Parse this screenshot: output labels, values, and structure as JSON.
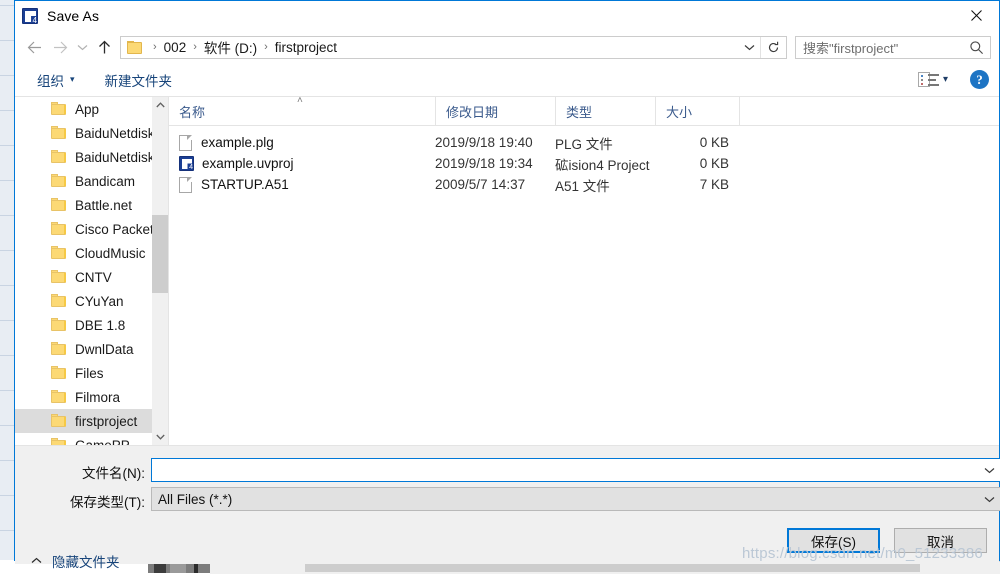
{
  "window": {
    "title": "Save As",
    "app_icon": "keil-uvision-icon",
    "close_label": "✕"
  },
  "nav": {
    "back_icon": "arrow-left-icon",
    "forward_icon": "arrow-right-icon",
    "history_icon": "chevron-down-icon",
    "up_icon": "arrow-up-icon",
    "folder_icon": "folder-icon",
    "breadcrumbs": [
      "002",
      "软件 (D:)",
      "firstproject"
    ],
    "separator": "›",
    "dropdown_icon": "chevron-down-icon",
    "refresh_icon": "refresh-icon",
    "refresh_glyph": "↻"
  },
  "search": {
    "placeholder": "搜索\"firstproject\"",
    "icon": "search-icon"
  },
  "commandbar": {
    "organize_label": "组织",
    "organize_caret": "▾",
    "new_folder_label": "新建文件夹",
    "view_icon": "list-view-icon",
    "view_caret": "▾",
    "help_label": "?",
    "help_icon": "help-icon"
  },
  "tree": {
    "items": [
      {
        "label": "App",
        "selected": false
      },
      {
        "label": "BaiduNetdisk",
        "selected": false
      },
      {
        "label": "BaiduNetdisk",
        "selected": false
      },
      {
        "label": "Bandicam",
        "selected": false
      },
      {
        "label": "Battle.net",
        "selected": false
      },
      {
        "label": "Cisco Packet ·",
        "selected": false
      },
      {
        "label": "CloudMusic",
        "selected": false
      },
      {
        "label": "CNTV",
        "selected": false
      },
      {
        "label": "CYuYan",
        "selected": false
      },
      {
        "label": "DBE 1.8",
        "selected": false
      },
      {
        "label": "DwnlData",
        "selected": false
      },
      {
        "label": "Files",
        "selected": false
      },
      {
        "label": "Filmora",
        "selected": false
      },
      {
        "label": "firstproject",
        "selected": true
      },
      {
        "label": "GamePP",
        "selected": false
      }
    ],
    "scroll_up_icon": "chevron-up-icon",
    "scroll_down_icon": "chevron-down-icon",
    "scroll_up_glyph": "ⱏ",
    "scroll_down_glyph": "ⱟ"
  },
  "filelist": {
    "columns": [
      {
        "key": "name",
        "label": "名称"
      },
      {
        "key": "date",
        "label": "修改日期"
      },
      {
        "key": "type",
        "label": "类型"
      },
      {
        "key": "size",
        "label": "大小"
      }
    ],
    "sort_indicator": "˄",
    "rows": [
      {
        "name": "example.plg",
        "date": "2019/9/18 19:40",
        "type": "PLG 文件",
        "size": "0 KB",
        "icon": "generic-file-icon"
      },
      {
        "name": "example.uvproj",
        "date": "2019/9/18 19:34",
        "type": "砿ision4 Project",
        "size": "0 KB",
        "icon": "keil-uvision-icon"
      },
      {
        "name": "STARTUP.A51",
        "date": "2009/5/7 14:37",
        "type": "A51 文件",
        "size": "7 KB",
        "icon": "generic-file-icon"
      }
    ]
  },
  "footer": {
    "filename_label": "文件名(N):",
    "filename_value": "",
    "filename_placeholder": "",
    "filetype_label": "保存类型(T):",
    "filetype_value": "All Files (*.*)",
    "filetype_caret": "∨",
    "filename_caret": "∨",
    "hide_folders_label": "隐藏文件夹",
    "hide_folders_chevron": "˄",
    "save_label": "保存(S)",
    "cancel_label": "取消"
  },
  "watermark": {
    "text": "https://blog.csdn.net/m0_51233386"
  },
  "colors": {
    "accent": "#0078d7",
    "command_text": "#17447a",
    "column_header_text": "#3a5a8c",
    "folder_yellow": "#fcd975",
    "selection_gray": "#dcdcdc",
    "footer_bg": "#f0f0f0"
  }
}
